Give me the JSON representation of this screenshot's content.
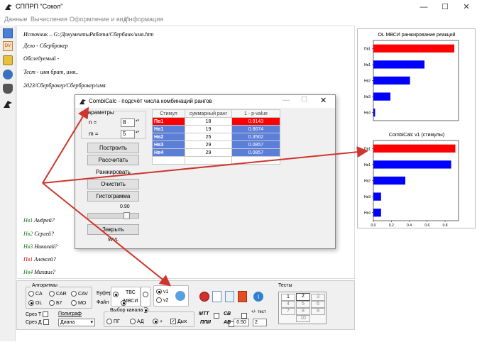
{
  "window": {
    "title": "СППРП \"Сокол\"",
    "minimize": "—",
    "maximize": "☐",
    "close": "✕"
  },
  "menu": [
    "Данные",
    "Вычисления",
    "Оформление и вид",
    "Информация"
  ],
  "main_lines": [
    {
      "text": "Источник – G:/ДокументыРабота/Сбербанк/имя.htm",
      "color": "#000000"
    },
    {
      "text": "Дело - Сберброкер",
      "color": "#000000"
    },
    {
      "text": "Обследуемый -",
      "color": "#000000"
    },
    {
      "text": "Тест - имя брат, имя..",
      "color": "#000000"
    },
    {
      "text": "2023/Сберброкер/Сберброкер/имя",
      "color": "#000000"
    }
  ],
  "names": [
    {
      "code": "Нв1",
      "name": "Андрей?",
      "color": "#1a7a1a"
    },
    {
      "code": "Нв2",
      "name": "Сергей?",
      "color": "#1a7a1a"
    },
    {
      "code": "Нв3",
      "name": "Николай?",
      "color": "#1a7a1a"
    },
    {
      "code": "Пв1",
      "name": "Алексей?",
      "color": "#d01010"
    },
    {
      "code": "Нв4",
      "name": "Михаил?",
      "color": "#1a7a1a"
    }
  ],
  "dialog": {
    "title": "CombiCalc - подсчёт числа комбинаций рангов",
    "params_label": "Параметры",
    "n_label": "n =",
    "n_value": "8",
    "m_label": "m =",
    "m_value": "5",
    "buttons": [
      "Построить",
      "Рассчитать",
      "Ранжировать",
      "Очистить",
      "Гистограмма"
    ],
    "slider_value": "0.90",
    "close_button": "Закрыть",
    "footer": "WVL",
    "table": {
      "headers": [
        "Стимул",
        "суммарный ранг",
        "1 - p-value"
      ],
      "rows": [
        {
          "stim": "Пв1",
          "rank": "18",
          "pval": "0.9143",
          "hl": "red"
        },
        {
          "stim": "Нв1",
          "rank": "19",
          "pval": "0.8674",
          "hl": "blue"
        },
        {
          "stim": "Нв2",
          "rank": "25",
          "pval": "0.3562",
          "hl": "blue"
        },
        {
          "stim": "Нв3",
          "rank": "29",
          "pval": "0.0857",
          "hl": "blue"
        },
        {
          "stim": "Нв4",
          "rank": "29",
          "pval": "0.0857",
          "hl": "blue"
        }
      ]
    }
  },
  "bottom": {
    "algorithms_label": "Алгоритмы",
    "algos": [
      {
        "label": "CA",
        "on": false
      },
      {
        "label": "CAR",
        "on": false
      },
      {
        "label": "CAV",
        "on": false
      },
      {
        "label": "OL",
        "on": true
      },
      {
        "label": "Б7",
        "on": false
      },
      {
        "label": "MO",
        "on": false
      }
    ],
    "slice_t": "Срез Т",
    "slice_d": "Срез Д",
    "polygraph": "Полиграф",
    "polygraph_value": "Диана",
    "buffer": "Буфер",
    "file": "Файл",
    "tvs": "ТВС",
    "mvsi": "МВСИ",
    "v1": "v1",
    "v2": "v2",
    "channel_label": "Выбор канала",
    "pg": "ПГ",
    "ad": "АД",
    "plus": "+",
    "dyh": "Дых",
    "mtt": "МТТ",
    "sv": "СВ",
    "pli": "ПЛИ",
    "av": "АВ",
    "av_value": "0.50",
    "pm_test": "+/- тест",
    "pm_value": "2",
    "tests_label": "Тесты",
    "tests": [
      "1",
      "2",
      "3",
      "4",
      "5",
      "6",
      "7",
      "8",
      "9",
      "10"
    ]
  },
  "charts": [
    {
      "title": "OL МВСИ ранжирование реакций"
    },
    {
      "title": "CombiCalc v1 (стимулы)"
    }
  ],
  "chart_data": [
    {
      "type": "bar",
      "title": "OL МВСИ ранжирование реакций",
      "categories": [
        "Пв1",
        "Нв1",
        "Нв2",
        "Нв3",
        "Нв4"
      ],
      "values": [
        0.95,
        0.6,
        0.43,
        0.2,
        0.02
      ],
      "colors": [
        "#ff0000",
        "#0000ff",
        "#0000ff",
        "#0000ff",
        "#0000ff"
      ],
      "xlim": [
        0,
        1
      ]
    },
    {
      "type": "bar",
      "title": "CombiCalc v1 (стимулы)",
      "categories": [
        "Пв1",
        "Нв1",
        "Нв2",
        "Нв3",
        "Нв4"
      ],
      "values": [
        0.9143,
        0.8674,
        0.3562,
        0.0857,
        0.0857
      ],
      "colors": [
        "#ff0000",
        "#0000ff",
        "#0000ff",
        "#0000ff",
        "#0000ff"
      ],
      "xlim": [
        0,
        0.95
      ],
      "xticks": [
        "0.0",
        "0.2",
        "0.4",
        "0.6",
        "0.8"
      ]
    }
  ]
}
